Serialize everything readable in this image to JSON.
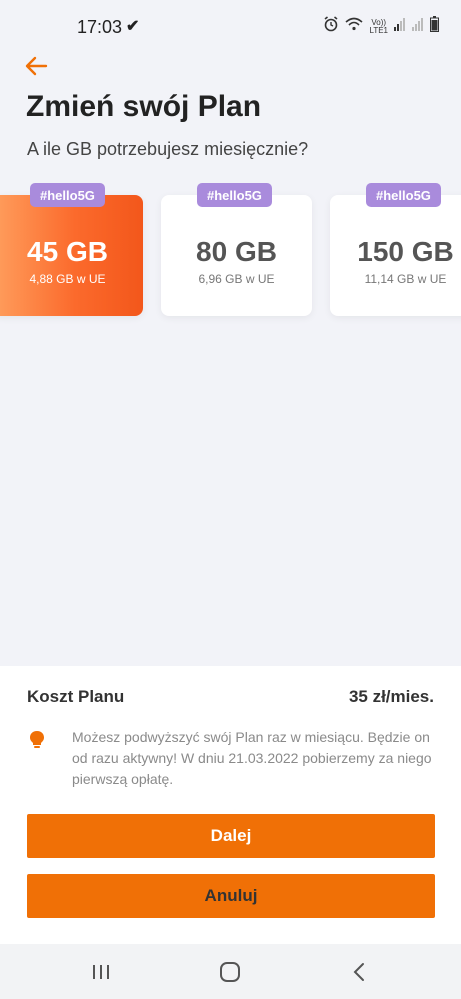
{
  "status_bar": {
    "time": "17:03",
    "check_glyph": "✔",
    "lte_top": "Vo))",
    "lte_bottom": "LTE1",
    "icons": [
      "alarm-icon",
      "wifi-icon",
      "signal-icon",
      "signal-icon",
      "battery-icon"
    ]
  },
  "header": {
    "title": "Zmień swój Plan",
    "subtitle": "A ile GB potrzebujesz miesięcznie?"
  },
  "plans": [
    {
      "badge": "#hello5G",
      "gb": "45 GB",
      "eu": "4,88 GB w UE",
      "selected": true
    },
    {
      "badge": "#hello5G",
      "gb": "80 GB",
      "eu": "6,96 GB w UE",
      "selected": false
    },
    {
      "badge": "#hello5G",
      "gb": "150 GB",
      "eu": "11,14 GB w UE",
      "selected": false
    }
  ],
  "summary": {
    "cost_label": "Koszt Planu",
    "cost_value": "35 zł/mies.",
    "info_text": "Możesz podwyższyć swój Plan raz w miesiącu. Będzie on od razu aktywny! W dniu 21.03.2022 pobierzemy za niego pierwszą opłatę.",
    "next_label": "Dalej",
    "cancel_label": "Anuluj"
  },
  "colors": {
    "accent": "#f07006",
    "badge": "#a98bdc",
    "background": "#f2f3f8"
  }
}
